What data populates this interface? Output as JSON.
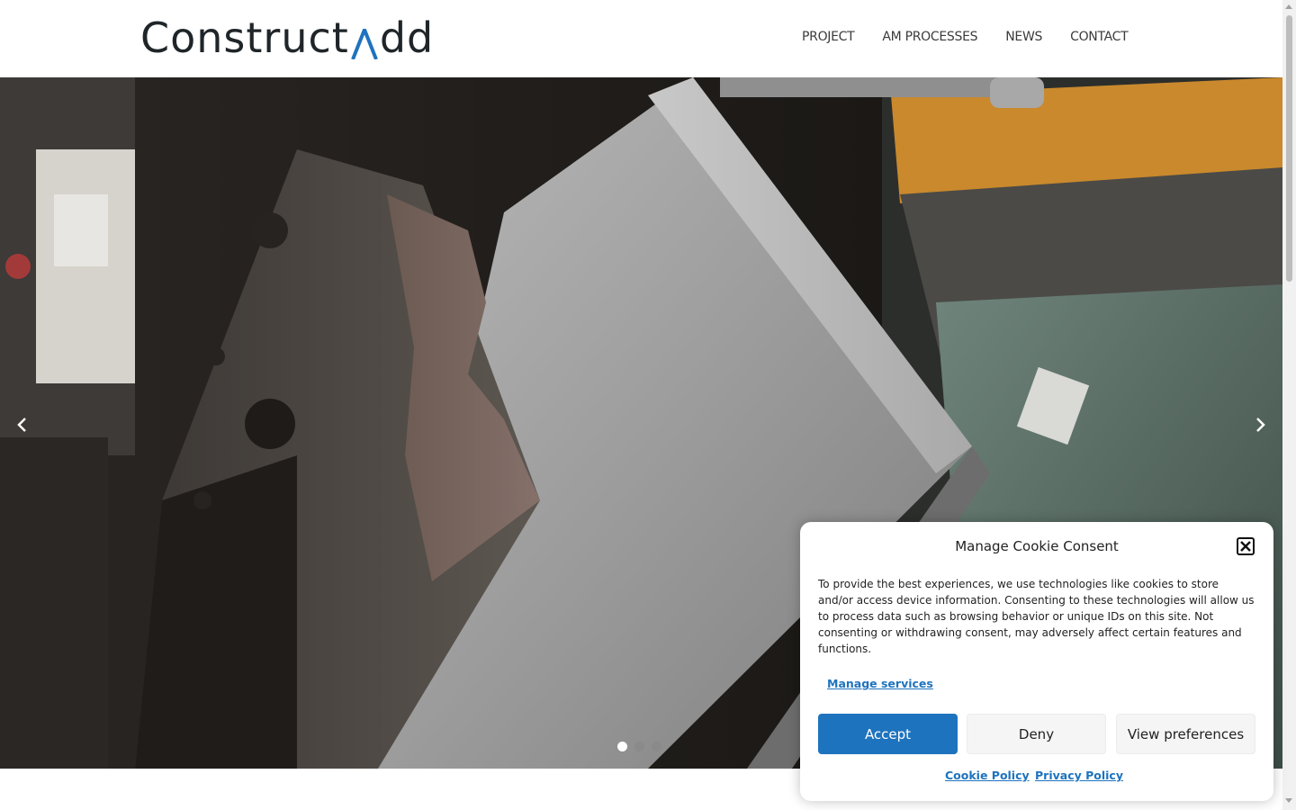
{
  "header": {
    "logo_left": "Construct",
    "logo_right": "dd",
    "nav": [
      "PROJECT",
      "AM PROCESSES",
      "NEWS",
      "CONTACT"
    ]
  },
  "hero": {
    "slides_total": 3,
    "active_slide": 1
  },
  "cookie": {
    "title": "Manage Cookie Consent",
    "text": "To provide the best experiences, we use technologies like cookies to store and/or access device information. Consenting to these technologies will allow us to process data such as browsing behavior or unique IDs on this site. Not consenting or withdrawing consent, may adversely affect certain features and functions.",
    "manage_services": "Manage services",
    "accept": "Accept",
    "deny": "Deny",
    "view_preferences": "View preferences",
    "cookie_policy": "Cookie Policy",
    "privacy_policy": "Privacy Policy"
  },
  "colors": {
    "accent": "#1e73be",
    "logo_mark": "#1e73be",
    "text_dark": "#1f2528"
  }
}
